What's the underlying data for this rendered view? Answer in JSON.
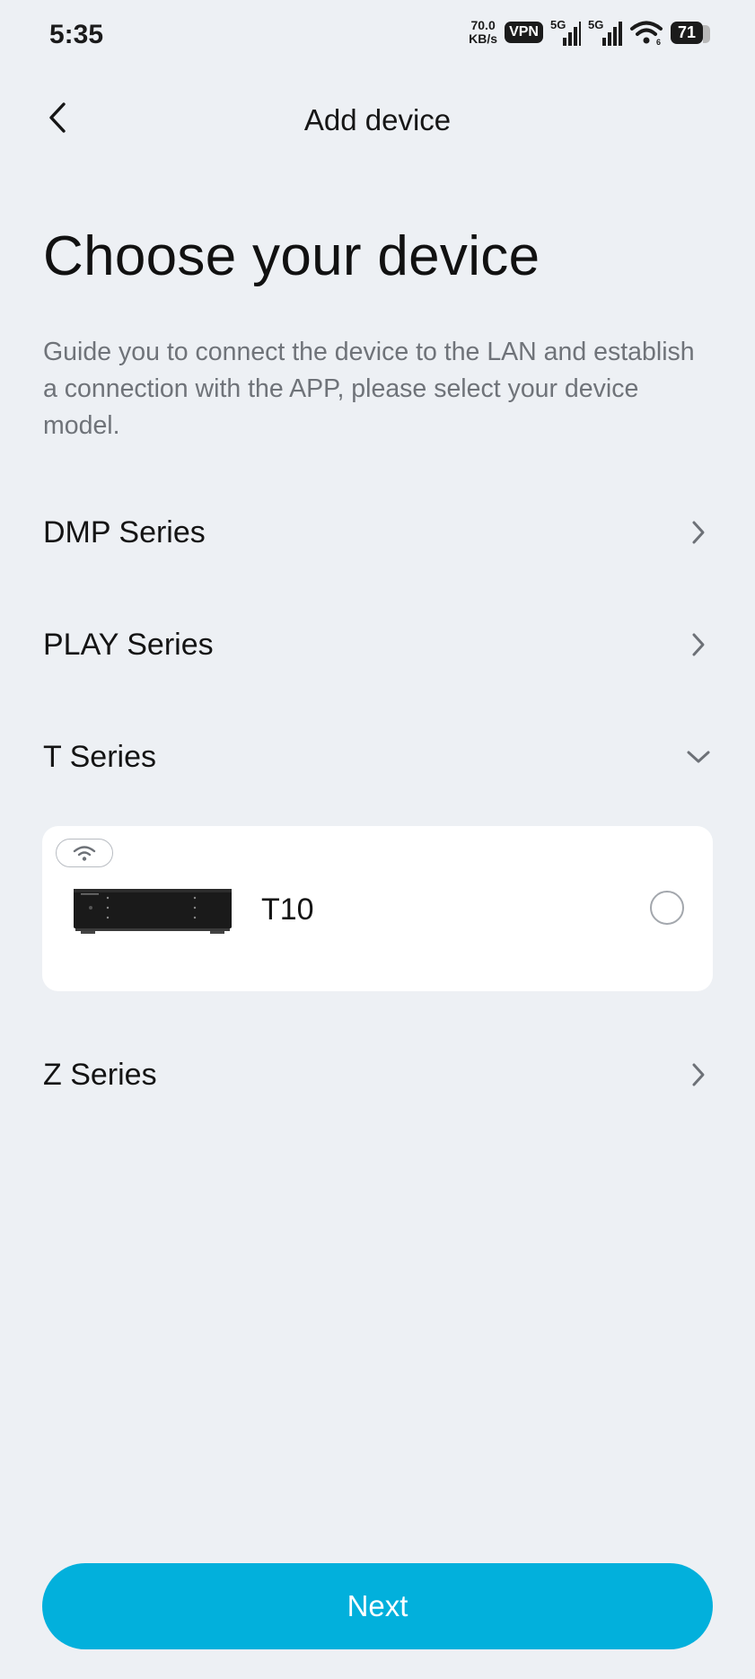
{
  "status_bar": {
    "time": "5:35",
    "net_speed_value": "70.0",
    "net_speed_unit": "KB/s",
    "vpn_label": "VPN",
    "sim1_label": "5G",
    "sim2_label": "5G",
    "battery_level": "71"
  },
  "header": {
    "title": "Add device",
    "back_icon": "chevron-left-icon"
  },
  "main": {
    "title": "Choose your device",
    "description": "Guide you to connect the device to the LAN and establish a connection with the APP, please select your device model."
  },
  "series": [
    {
      "label": "DMP Series",
      "state": "collapsed"
    },
    {
      "label": "PLAY Series",
      "state": "collapsed"
    },
    {
      "label": "T Series",
      "state": "expanded"
    },
    {
      "label": "Z Series",
      "state": "collapsed"
    }
  ],
  "device": {
    "name": "T10",
    "connection_icon": "wifi-icon",
    "selected": false
  },
  "footer": {
    "next_label": "Next"
  },
  "colors": {
    "background": "#edf0f4",
    "accent": "#02b0dc",
    "card": "#ffffff"
  }
}
